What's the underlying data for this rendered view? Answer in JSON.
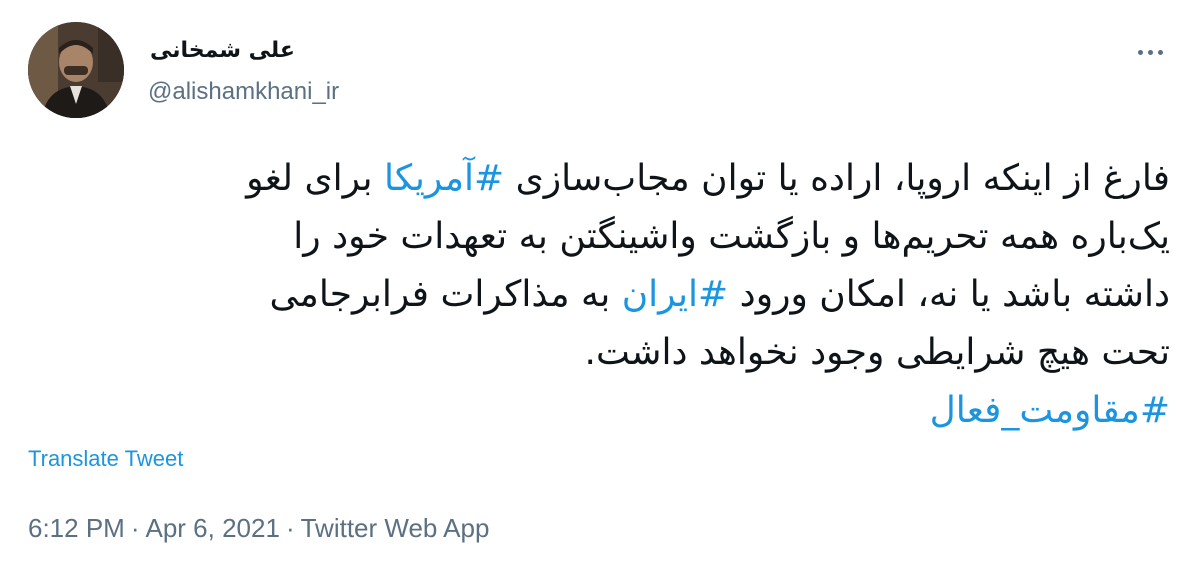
{
  "author": {
    "display_name": "علی شمخانی",
    "handle": "@alishamkhani_ir"
  },
  "tweet": {
    "lines": [
      {
        "before": "فارغ از اینکه اروپا، اراده یا توان مجاب‌سازی ",
        "hashtag": "#آمریکا",
        "after": " برای لغو"
      },
      {
        "text": "یک‌باره همه تحریم‌ها و بازگشت واشینگتن به تعهدات خود را"
      },
      {
        "before": "داشته باشد یا نه، امکان ورود ",
        "hashtag": "#ایران",
        "after": " به مذاکرات فرابرجامی"
      },
      {
        "text": "تحت هیچ شرایطی وجود نخواهد داشت."
      },
      {
        "hashtag": "#مقاومت_فعال"
      }
    ]
  },
  "translate_label": "Translate Tweet",
  "meta": {
    "time": "6:12 PM",
    "separator": "·",
    "date": "Apr 6, 2021",
    "source": "Twitter Web App"
  },
  "colors": {
    "text": "#0f1419",
    "secondary": "#5b7083",
    "link": "#1b95e0"
  }
}
